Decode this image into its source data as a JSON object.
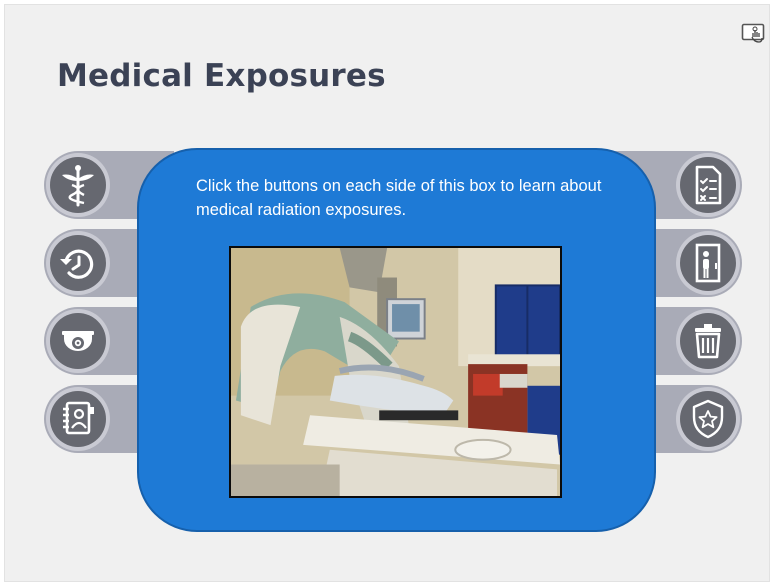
{
  "page": {
    "title": "Medical Exposures"
  },
  "content": {
    "intro_text": "Click the buttons on each side of this box to learn about medical radiation exposures."
  },
  "left_buttons": [
    {
      "icon": "caduceus-icon"
    },
    {
      "icon": "history-icon"
    },
    {
      "icon": "security-camera-icon"
    },
    {
      "icon": "contact-book-icon"
    }
  ],
  "right_buttons": [
    {
      "icon": "checklist-document-icon"
    },
    {
      "icon": "person-doorway-icon"
    },
    {
      "icon": "trash-can-icon"
    },
    {
      "icon": "police-badge-icon"
    }
  ],
  "colors": {
    "title": "#3b4255",
    "box": "#1e7ad6",
    "tab": "#a9abb7",
    "icon_circle": "#666870",
    "background": "#f0f0f0"
  }
}
